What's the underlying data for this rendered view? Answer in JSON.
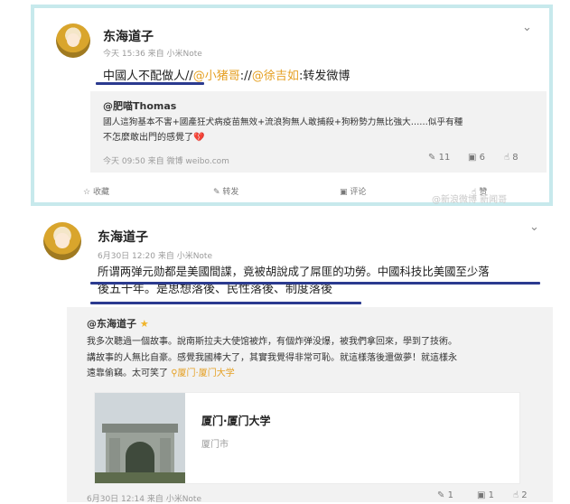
{
  "post1": {
    "author": "东海道子",
    "meta": "今天 15:36 来自 小米Note",
    "body_prefix": "中國人不配做人//",
    "mention_a": "@小猪哥",
    "sep": "://",
    "mention_b": "@徐吉如",
    "body_suffix": ":转发微博",
    "quote": {
      "author": "@肥喵Thomas",
      "text_line1": "國人這狗基本不害+國產狂犬病疫苗無效+流浪狗無人敢捕殺+狗粉勢力無比強大……似乎有種",
      "text_line2": "不怎麼敢出門的感覺了",
      "heart": "💔",
      "meta": "今天 09:50 来自 微博 weibo.com",
      "stats": {
        "forward": "11",
        "comment": "6",
        "like": "8"
      }
    },
    "actions": {
      "collect": "收藏",
      "forward": "转发",
      "comment": "评论",
      "like": "赞"
    },
    "watermark": "@新浪微博 新闻哥"
  },
  "post2": {
    "author": "东海道子",
    "meta": "6月30日 12:20 来自 小米Note",
    "body_line1": "所谓两弹元勋都是美國間諜，竟被胡說成了屌匪的功勞。中國科技比美國至少落",
    "body_line2": "後五千年。是思想落後、民性落後、制度落後",
    "quote": {
      "author": "@东海道子",
      "text_line1": "我多次聽過一個故事。說南斯拉夫大使馆被炸，有個炸弹没爆，被我們拿回來，學到了技術。",
      "text_line2": "講故事的人無比自豪。感覺我國棒大了，其實我覺得非常可恥。就這樣落後還做夢！就這樣永",
      "text_line3": "遠靠偷竊。太可笑了",
      "location": "厦门·厦门大学",
      "place": {
        "title": "厦门·厦门大学",
        "subtitle": "厦门市"
      },
      "meta": "6月30日 12:14 来自 小米Note",
      "stats": {
        "forward": "1",
        "comment": "1",
        "like": "2"
      }
    }
  }
}
